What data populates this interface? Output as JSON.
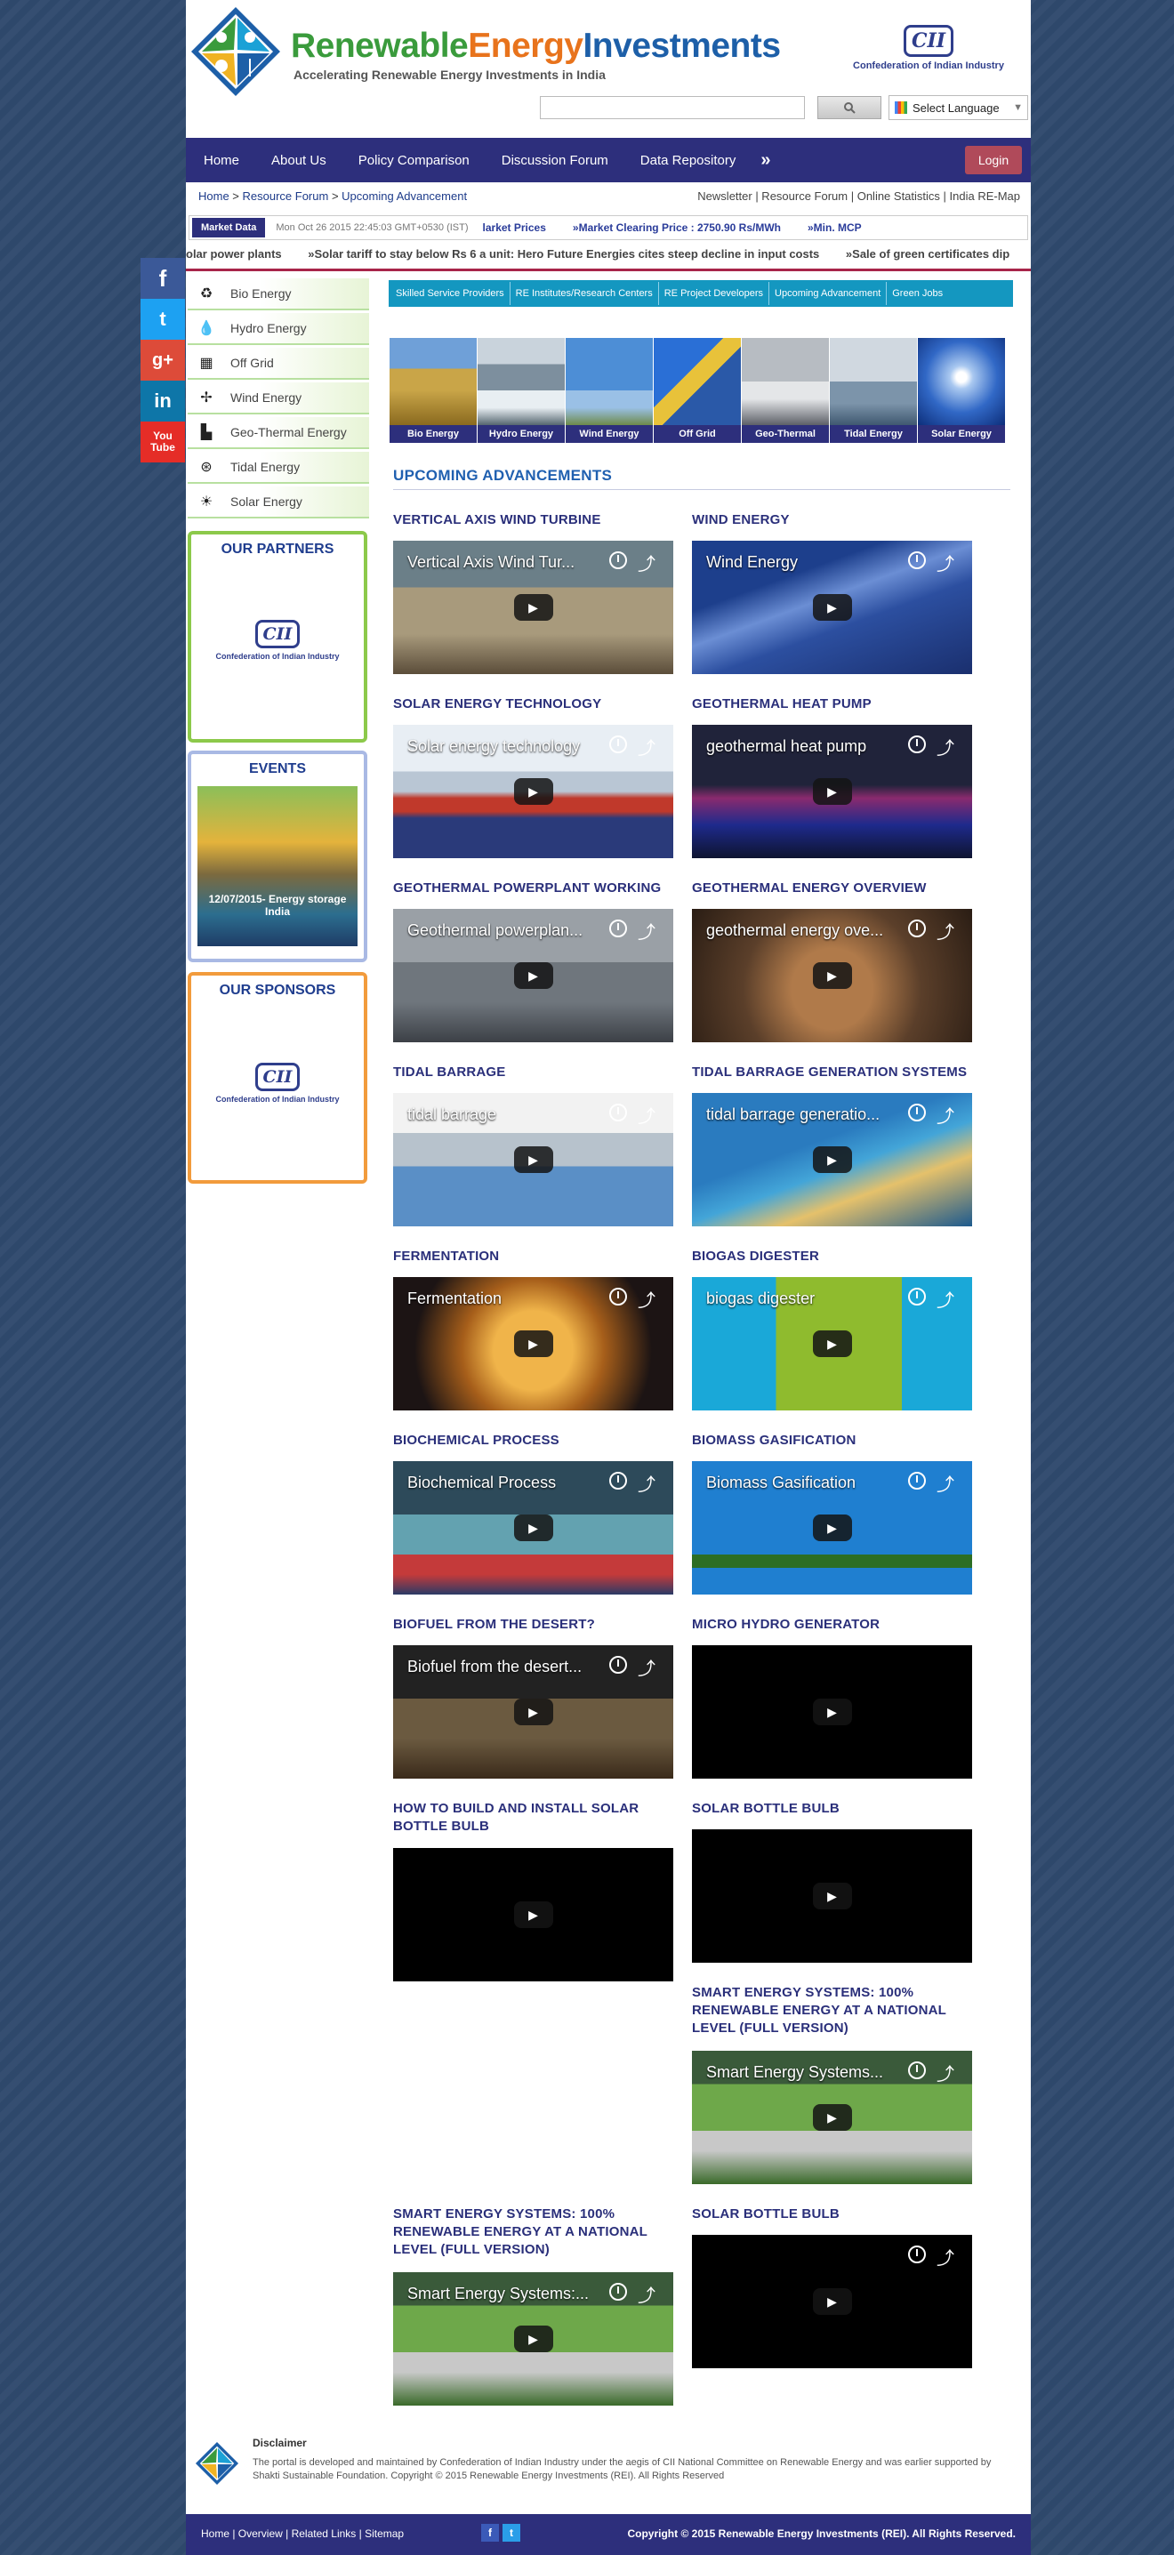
{
  "header": {
    "title_part1": "Renewable",
    "title_part2": "Energy",
    "title_part3": "Investments",
    "tagline": "Accelerating Renewable Energy Investments in India",
    "cii_mark": "CII",
    "cii_name": "Confederation of Indian Industry",
    "search_placeholder": "",
    "language_label": "Select Language"
  },
  "nav": {
    "items": [
      "Home",
      "About Us",
      "Policy Comparison",
      "Discussion Forum",
      "Data Repository"
    ],
    "more": "»",
    "login": "Login"
  },
  "breadcrumb": {
    "home": "Home",
    "sep1": " > ",
    "forum": "Resource Forum",
    "sep2": " > ",
    "current": "Upcoming Advancement"
  },
  "toplinks": "Newsletter | Resource Forum | Online Statistics | India RE-Map",
  "market": {
    "tag": "Market Data",
    "time": "Mon Oct 26 2015 22:45:03 GMT+0530 (IST)",
    "items": [
      "larket Prices",
      "»Market Clearing Price : 2750.90 Rs/MWh",
      "»Min. MCP"
    ]
  },
  "news": [
    "olar power plants",
    "»Solar tariff to stay below Rs 6 a unit: Hero Future Energies cites steep decline in input costs",
    "»Sale of green certificates dip"
  ],
  "social": [
    "f",
    "t",
    "g+",
    "in",
    "You Tube"
  ],
  "sidebar": {
    "energy_items": [
      "Bio Energy",
      "Hydro Energy",
      "Off Grid",
      "Wind Energy",
      "Geo-Thermal Energy",
      "Tidal Energy",
      "Solar Energy"
    ],
    "partners_title": "OUR PARTNERS",
    "events_title": "EVENTS",
    "events_caption": "12/07/2015- Energy storage India",
    "sponsors_title": "OUR SPONSORS"
  },
  "categories": [
    "Skilled Service Providers",
    "RE Institutes/Research Centers",
    "RE Project Developers",
    "Upcoming Advancement",
    "Green Jobs"
  ],
  "thumbnails": [
    "Bio Energy",
    "Hydro Energy",
    "Wind Energy",
    "Off Grid",
    "Geo-Thermal",
    "Tidal Energy",
    "Solar Energy"
  ],
  "section_title": "UPCOMING ADVANCEMENTS",
  "videos": [
    {
      "title": "VERTICAL AXIS WIND TURBINE",
      "overlay": "Vertical Axis Wind Tur...",
      "controls": true
    },
    {
      "title": "WIND ENERGY",
      "overlay": "Wind Energy",
      "controls": true
    },
    {
      "title": "SOLAR ENERGY TECHNOLOGY",
      "overlay": "Solar energy technology",
      "controls": true
    },
    {
      "title": "GEOTHERMAL HEAT PUMP",
      "overlay": "geothermal heat pump",
      "controls": true
    },
    {
      "title": "GEOTHERMAL POWERPLANT WORKING",
      "overlay": "Geothermal powerplan...",
      "controls": true
    },
    {
      "title": "GEOTHERMAL ENERGY OVERVIEW",
      "overlay": "geothermal energy ove...",
      "controls": true
    },
    {
      "title": "TIDAL BARRAGE",
      "overlay": "tidal barrage",
      "controls": true
    },
    {
      "title": "TIDAL BARRAGE GENERATION SYSTEMS",
      "overlay": "tidal barrage generatio...",
      "controls": true
    },
    {
      "title": "FERMENTATION",
      "overlay": "Fermentation",
      "controls": true
    },
    {
      "title": "BIOGAS DIGESTER",
      "overlay": "biogas digester",
      "controls": true
    },
    {
      "title": "BIOCHEMICAL PROCESS",
      "overlay": "Biochemical Process",
      "controls": true
    },
    {
      "title": "BIOMASS GASIFICATION",
      "overlay": "Biomass Gasification",
      "controls": true
    },
    {
      "title": "BIOFUEL FROM THE DESERT?",
      "overlay": "Biofuel from the desert...",
      "controls": true
    },
    {
      "title": "MICRO HYDRO GENERATOR",
      "overlay": "",
      "controls": false
    },
    {
      "title": "HOW TO BUILD AND INSTALL SOLAR BOTTLE BULB",
      "overlay": "",
      "controls": false
    },
    {
      "title": "SOLAR BOTTLE BULB",
      "overlay": "",
      "controls": false
    },
    {
      "title": "SMART ENERGY SYSTEMS: 100% RENEWABLE ENERGY AT A NATIONAL LEVEL (FULL VERSION)",
      "overlay": "Smart Energy Systems...",
      "controls": true
    },
    {
      "title": "SMART ENERGY SYSTEMS: 100% RENEWABLE ENERGY AT A NATIONAL LEVEL (FULL VERSION)",
      "overlay": "Smart Energy Systems:...",
      "controls": true
    },
    {
      "title": "SOLAR BOTTLE BULB",
      "overlay": "",
      "controls": true
    }
  ],
  "footer": {
    "disclaimer_title": "Disclaimer",
    "disclaimer_text": "The portal is developed and maintained by Confederation of Indian Industry under the aegis of CII National Committee on Renewable Energy and was earlier supported by Shakti Sustainable Foundation. Copyright © 2015 Renewable Energy Investments (REI). All Rights Reserved",
    "links": "Home  |  Overview |  Related Links | Sitemap",
    "copyright": "Copyright © 2015 Renewable Energy Investments (REI). All Rights Reserved."
  },
  "colors": {
    "nav": "#2d2f7c",
    "accent_blue": "#1497c0",
    "login": "#b04a5a",
    "title_green": "#3a9b3c",
    "title_orange": "#e8731c",
    "title_blue": "#1d5fa8"
  }
}
